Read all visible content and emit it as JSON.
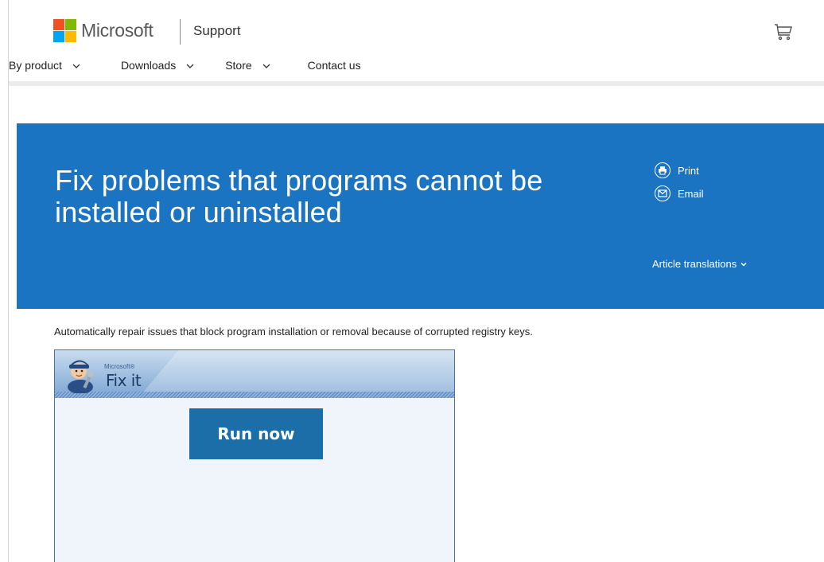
{
  "header": {
    "brand": "Microsoft",
    "section": "Support",
    "brand_colors": [
      "#f25022",
      "#7fba00",
      "#00a4ef",
      "#ffb900"
    ]
  },
  "nav": {
    "items": [
      {
        "label": "By product",
        "has_dropdown": true
      },
      {
        "label": "Downloads",
        "has_dropdown": true
      },
      {
        "label": "Store",
        "has_dropdown": true
      },
      {
        "label": "Contact us",
        "has_dropdown": false
      }
    ]
  },
  "hero": {
    "title": "Fix problems that programs cannot be installed or uninstalled",
    "print_label": "Print",
    "email_label": "Email",
    "translations_label": "Article translations",
    "background": "#1a74c2"
  },
  "article": {
    "intro": "Automatically repair issues that block program installation or removal because of corrupted registry keys."
  },
  "fixit": {
    "brand_small": "Microsoft®",
    "brand_name": "Fix it",
    "button_label": "Run now",
    "button_color": "#1c6ea8"
  },
  "icons": [
    "cart-icon",
    "print-icon",
    "email-icon",
    "chevron-down-icon",
    "fixit-mascot-icon"
  ]
}
